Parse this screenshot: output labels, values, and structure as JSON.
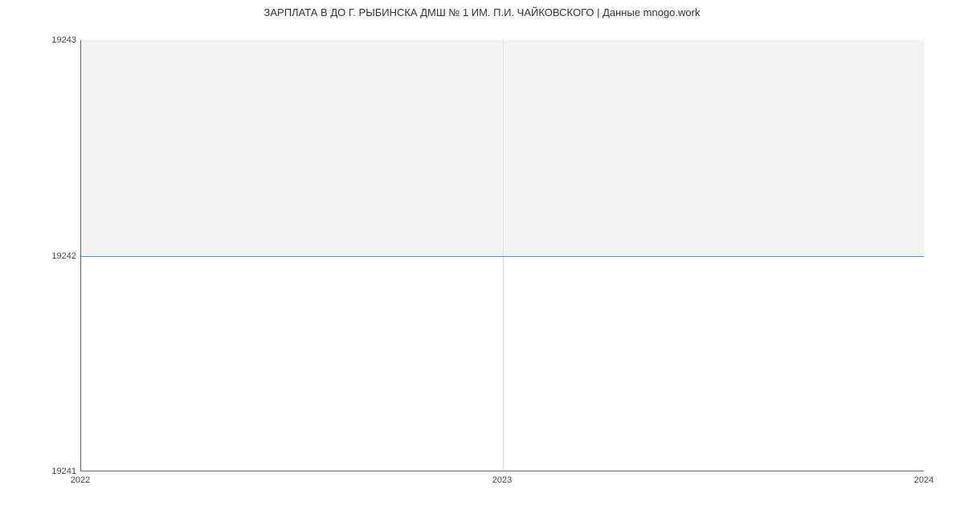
{
  "chart_data": {
    "type": "area",
    "title": "ЗАРПЛАТА В ДО Г. РЫБИНСКА ДМШ № 1 ИМ. П.И. ЧАЙКОВСКОГО | Данные mnogo.work",
    "x": [
      2022,
      2023,
      2024
    ],
    "y": [
      19242,
      19242,
      19242
    ],
    "xlabel": "",
    "ylabel": "",
    "x_ticks": [
      "2022",
      "2023",
      "2024"
    ],
    "y_ticks": [
      "19241",
      "19242",
      "19243"
    ],
    "xlim": [
      2022,
      2024
    ],
    "ylim": [
      19241,
      19243
    ],
    "colors": {
      "line": "#4a90e2",
      "fill": "#f4f4f4"
    }
  }
}
